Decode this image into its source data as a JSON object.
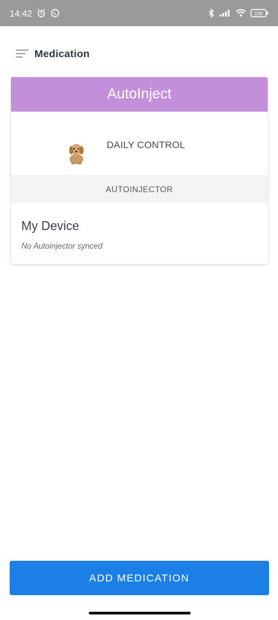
{
  "status_bar": {
    "time": "14:42",
    "battery": "100",
    "icons": [
      "alarm-icon",
      "whatsapp-icon",
      "bluetooth-icon",
      "signal-icon",
      "wifi-icon",
      "battery-icon"
    ]
  },
  "app_bar": {
    "title": "Medication",
    "menu_icon": "menu-icon"
  },
  "device_card": {
    "header": "AutoInject",
    "header_color": "#c38fdb",
    "product": {
      "label": "DAILY CONTROL",
      "image": "dog-image"
    },
    "section_label": "AUTOINJECTOR",
    "device_name": "My Device",
    "device_status": "No Autoinjector synced"
  },
  "footer": {
    "add_button_label": "ADD MEDICATION",
    "button_color": "#1b7fe6"
  }
}
